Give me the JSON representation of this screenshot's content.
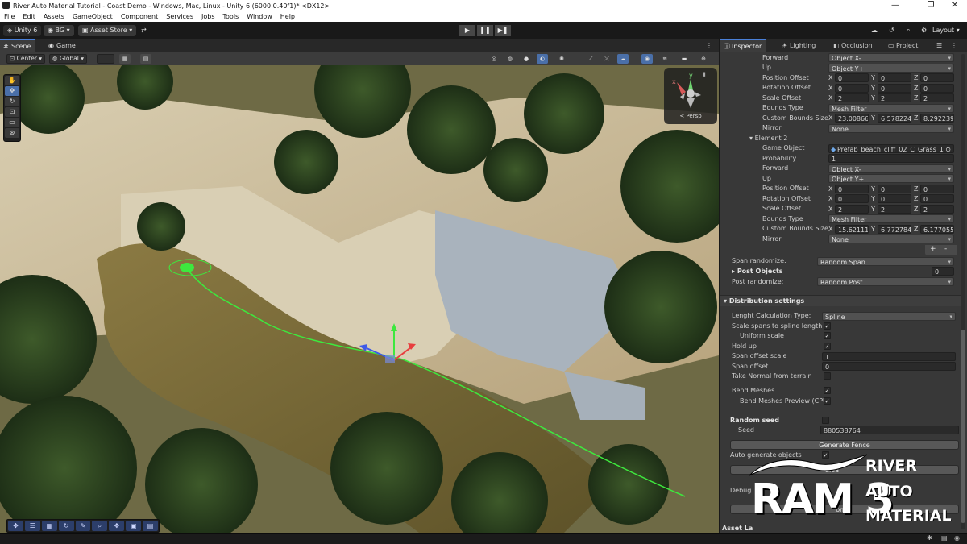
{
  "window": {
    "title": "River Auto Material Tutorial - Coast Demo - Windows, Mac, Linux - Unity 6 (6000.0.40f1)* <DX12>",
    "controls": [
      "—",
      "❐",
      "✕"
    ]
  },
  "menu": [
    "File",
    "Edit",
    "Assets",
    "GameObject",
    "Component",
    "Services",
    "Jobs",
    "Tools",
    "Window",
    "Help"
  ],
  "toolbar": {
    "account": "Unity 6",
    "org": "BG",
    "asset_store": "Asset Store",
    "layout": "Layout"
  },
  "scene_tabs": [
    {
      "label": "Scene"
    },
    {
      "label": "Game"
    }
  ],
  "scene_toolbar": {
    "pivot": "Center",
    "space": "Global",
    "snap": "1"
  },
  "gizmo": {
    "label": "< Persp",
    "axis_y": "y",
    "axis_x": "x"
  },
  "inspector_tabs": [
    {
      "label": "Inspector"
    },
    {
      "label": "Lighting"
    },
    {
      "label": "Occlusion"
    },
    {
      "label": "Project"
    }
  ],
  "inspector": {
    "e1": {
      "forward_label": "Forward",
      "forward_value": "Object X-",
      "up_label": "Up",
      "up_value": "Object Y+",
      "position_offset_label": "Position Offset",
      "position_offset": [
        "0",
        "0",
        "0"
      ],
      "rotation_offset_label": "Rotation Offset",
      "rotation_offset": [
        "0",
        "0",
        "0"
      ],
      "scale_offset_label": "Scale Offset",
      "scale_offset": [
        "2",
        "2",
        "2"
      ],
      "bounds_type_label": "Bounds Type",
      "bounds_type": "Mesh Filter",
      "custom_bounds_label": "Custom Bounds Size",
      "custom_bounds": [
        "23.00866",
        "6.578224",
        "8.292239"
      ],
      "mirror_label": "Mirror",
      "mirror": "None"
    },
    "element2_label": "Element 2",
    "e2": {
      "game_object_label": "Game Object",
      "game_object": "Prefab_beach_cliff_02_C_Grass_1",
      "probability_label": "Probability",
      "probability": "1",
      "forward_label": "Forward",
      "forward_value": "Object X-",
      "up_label": "Up",
      "up_value": "Object Y+",
      "position_offset_label": "Position Offset",
      "position_offset": [
        "0",
        "0",
        "0"
      ],
      "rotation_offset_label": "Rotation Offset",
      "rotation_offset": [
        "0",
        "0",
        "0"
      ],
      "scale_offset_label": "Scale Offset",
      "scale_offset": [
        "2",
        "2",
        "2"
      ],
      "bounds_type_label": "Bounds Type",
      "bounds_type": "Mesh Filter",
      "custom_bounds_label": "Custom Bounds Size",
      "custom_bounds": [
        "15.62111",
        "6.772784",
        "6.177055"
      ],
      "mirror_label": "Mirror",
      "mirror": "None"
    },
    "axes": [
      "X",
      "Y",
      "Z"
    ],
    "add_btn": "+",
    "remove_btn": "-",
    "span_randomize_label": "Span randomize:",
    "span_randomize": "Random Span",
    "post_objects_label": "Post Objects",
    "post_objects_count": "0",
    "post_randomize_label": "Post randomize:",
    "post_randomize": "Random Post",
    "distribution_header": "Distribution settings",
    "length_calc_label": "Lenght Calculation Type:",
    "length_calc": "Spline",
    "scale_spans_label": "Scale spans to spline length",
    "uniform_scale_label": "Uniform scale",
    "hold_up_label": "Hold up",
    "span_offset_scale_label": "Span offset scale",
    "span_offset_scale": "1",
    "span_offset_label": "Span offset",
    "span_offset": "0",
    "take_normal_label": "Take Normal from terrain",
    "bend_meshes_label": "Bend Meshes",
    "bend_preview_label": "Bend Meshes Preview (CPU I",
    "random_seed_header": "Random seed",
    "seed_label": "Seed",
    "seed_value": "880538764",
    "generate_fence_btn": "Generate Fence",
    "auto_generate_label": "Auto generate objects",
    "clear_btn": "Clea",
    "debug_label": "Debug",
    "comp_btn": "omp",
    "asset_label": "Asset La"
  },
  "logo": {
    "big": "RAM 3",
    "line1": "RIVER",
    "line2": "AUTO",
    "line3": "MATERIAL"
  },
  "colors": {
    "accent": "#4a80d8",
    "spline": "#3ee83e"
  }
}
